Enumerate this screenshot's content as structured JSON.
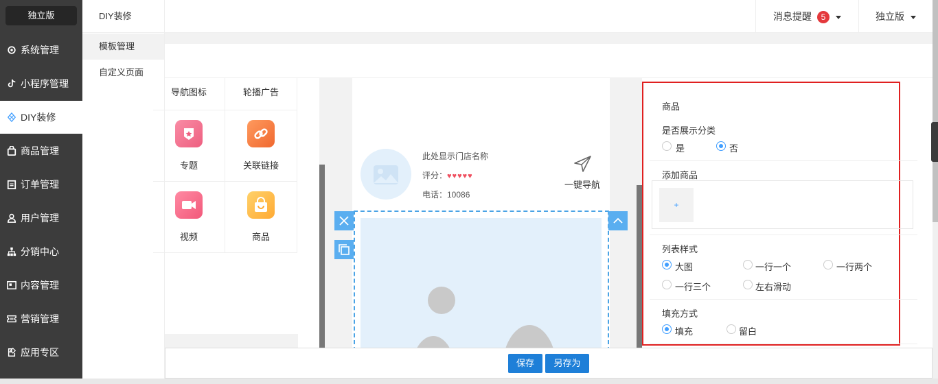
{
  "sidebar": {
    "brand": "独立版",
    "items": [
      {
        "label": "系统管理",
        "icon": "gear-icon"
      },
      {
        "label": "小程序管理",
        "icon": "tiktok-icon"
      },
      {
        "label": "DIY装修",
        "icon": "diamond-icon"
      },
      {
        "label": "商品管理",
        "icon": "bag-icon"
      },
      {
        "label": "订单管理",
        "icon": "clipboard-icon"
      },
      {
        "label": "用户管理",
        "icon": "user-icon"
      },
      {
        "label": "分销中心",
        "icon": "hierarchy-icon"
      },
      {
        "label": "内容管理",
        "icon": "content-icon"
      },
      {
        "label": "营销管理",
        "icon": "ticket-icon"
      },
      {
        "label": "应用专区",
        "icon": "app-icon"
      }
    ]
  },
  "subnav": {
    "title": "DIY装修",
    "items": [
      "模板管理",
      "自定义页面"
    ]
  },
  "topbar": {
    "messages_label": "消息提醒",
    "messages_count": "5",
    "version_label": "独立版"
  },
  "components": {
    "header_left": "导航图标",
    "header_right": "轮播广告",
    "items": [
      {
        "label": "专题",
        "icon": "topic-icon",
        "color": "#f06f8d"
      },
      {
        "label": "关联链接",
        "icon": "link-icon",
        "color": "#f57c45"
      },
      {
        "label": "视频",
        "icon": "video-icon",
        "color": "#f05d7a"
      },
      {
        "label": "商品",
        "icon": "shopping-bag-icon",
        "color": "#ffb547"
      }
    ]
  },
  "preview": {
    "store_name": "此处显示门店名称",
    "rating_label": "评分：",
    "hearts": "♥♥♥♥♥",
    "phone": "电话：10086",
    "navigate": "一键导航"
  },
  "settings": {
    "title": "商品",
    "show_category": {
      "label": "是否展示分类",
      "options": [
        "是",
        "否"
      ],
      "selected": "否"
    },
    "add_goods": {
      "label": "添加商品",
      "button": "+"
    },
    "list_style": {
      "label": "列表样式",
      "options": [
        "大图",
        "一行一个",
        "一行两个",
        "一行三个",
        "左右滑动"
      ],
      "selected": "大图"
    },
    "fill_mode": {
      "label": "填充方式",
      "options": [
        "填充",
        "留白"
      ],
      "selected": "填充"
    }
  },
  "footer": {
    "save": "保存",
    "save_as": "另存为"
  }
}
